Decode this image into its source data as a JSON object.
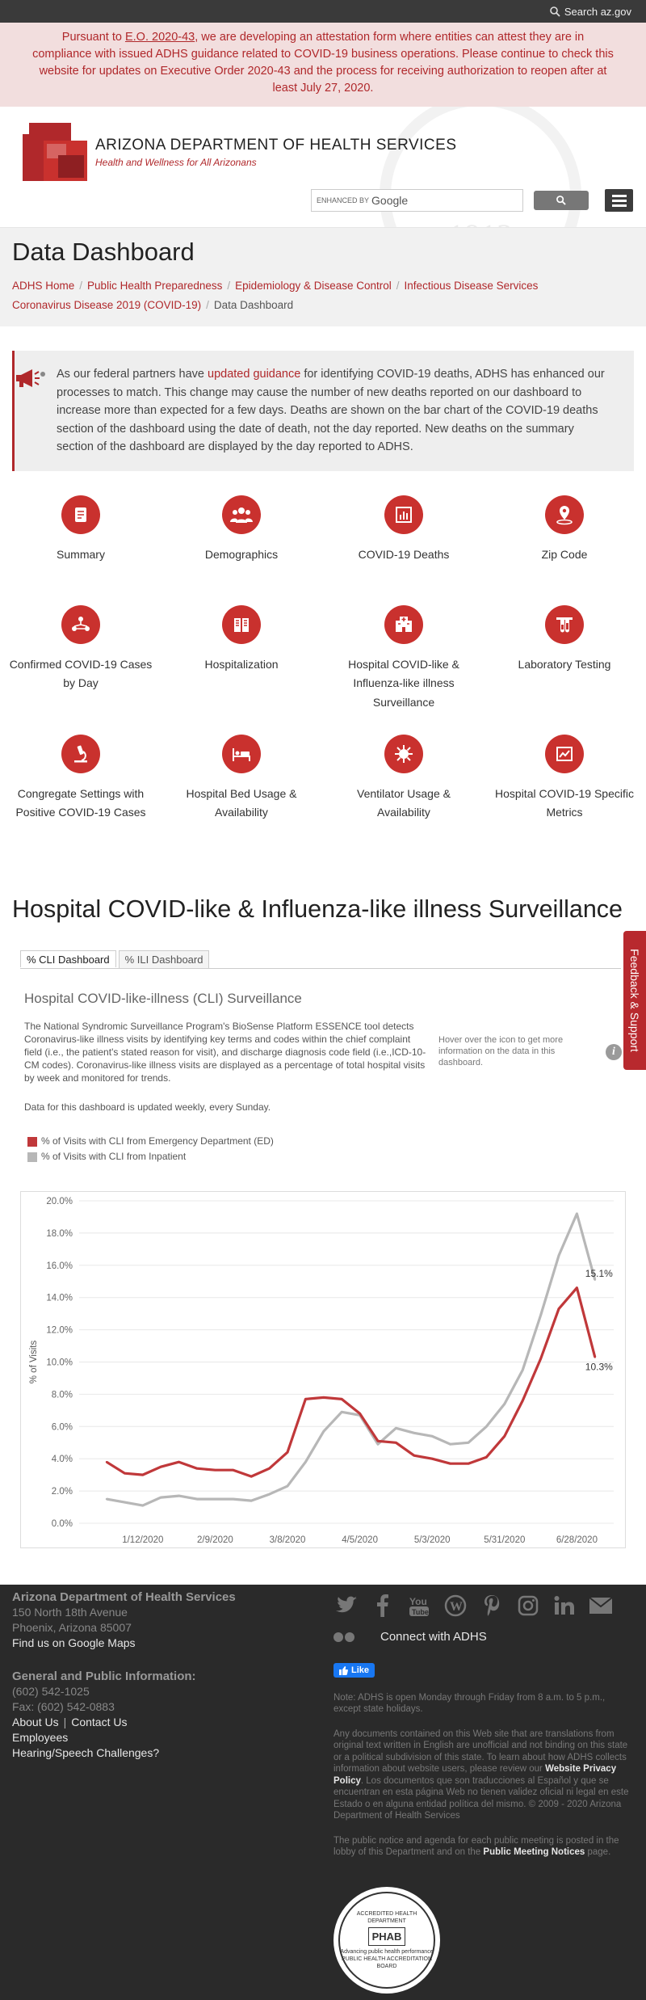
{
  "topbar": {
    "search_link": "Search az.gov"
  },
  "alert": {
    "part1": "Pursuant to ",
    "eo_link": "E.O. 2020-43",
    "part2": ", we are developing an attestation form where entities can attest they are in compliance with issued ADHS guidance related to COVID-19 business operations. Please continue to check this website for updates on Executive Order 2020-43 and the process for receiving authorization to reopen after at least July 27, 2020."
  },
  "header": {
    "title": "ARIZONA DEPARTMENT OF HEALTH SERVICES",
    "tagline": "Health and Wellness for All Arizonans",
    "seal_year": "1912",
    "search_enhanced": "ENHANCED BY",
    "search_google": "Google",
    "search_button_icon": "search-icon",
    "menu_icon": "hamburger-icon"
  },
  "page": {
    "title": "Data Dashboard",
    "breadcrumbs": [
      "ADHS Home",
      "Public Health Preparedness",
      "Epidemiology & Disease Control",
      "Infectious Disease Services",
      "Coronavirus Disease 2019 (COVID-19)",
      "Data Dashboard"
    ]
  },
  "notice": {
    "pre": "As our federal partners have ",
    "link": "updated guidance",
    "post": " for identifying COVID-19 deaths, ADHS has enhanced our processes to match. This change may cause the number of new deaths reported on our dashboard to increase more than expected for a few days. Deaths are shown on the bar chart of the COVID-19 deaths section of the dashboard using the date of death, not the day reported. New deaths on the summary section of the dashboard are displayed by the day reported to ADHS."
  },
  "dashboard_links": [
    {
      "label": "Summary",
      "icon": "document-icon"
    },
    {
      "label": "Demographics",
      "icon": "people-icon"
    },
    {
      "label": "COVID-19 Deaths",
      "icon": "bar-chart-icon"
    },
    {
      "label": "Zip Code",
      "icon": "location-pin-icon"
    },
    {
      "label": "Confirmed COVID-19 Cases by Day",
      "icon": "network-icon"
    },
    {
      "label": "Hospitalization",
      "icon": "hospital-building-icon"
    },
    {
      "label": "Hospital COVID-like & Influenza-like illness Surveillance",
      "icon": "hospital-icon"
    },
    {
      "label": "Laboratory Testing",
      "icon": "test-tube-icon"
    },
    {
      "label": "Congregate Settings with Positive COVID-19 Cases",
      "icon": "microscope-icon"
    },
    {
      "label": "Hospital Bed Usage & Availability",
      "icon": "bed-icon"
    },
    {
      "label": "Ventilator Usage & Availability",
      "icon": "virus-icon"
    },
    {
      "label": "Hospital COVID-19 Specific Metrics",
      "icon": "line-chart-icon"
    }
  ],
  "section": {
    "title": "Hospital COVID-like & Influenza-like illness Surveillance",
    "tabs": [
      "% CLI Dashboard",
      "% ILI Dashboard"
    ],
    "cli_title": "Hospital COVID-like-illness (CLI) Surveillance",
    "cli_desc": "The National Syndromic Surveillance Program's BioSense Platform ESSENCE tool detects Coronavirus-like illness visits by identifying key terms and codes within the chief complaint field (i.e., the patient's stated reason for visit), and discharge diagnosis code field (i.e.,ICD-10-CM codes).  Coronavirus-like illness visits are displayed as a percentage of total hospital visits by week and monitored for trends.",
    "cli_update": "Data for this dashboard is updated weekly, every Sunday.",
    "hover_note": "Hover over the icon to get more information on the data in this dashboard.",
    "info_icon": "info-icon",
    "feedback": "Feedback & Support"
  },
  "chart_data": {
    "type": "line",
    "ylabel": "% of Visits",
    "ylim": [
      0,
      20
    ],
    "yticks": [
      "0.0%",
      "2.0%",
      "4.0%",
      "6.0%",
      "8.0%",
      "10.0%",
      "12.0%",
      "14.0%",
      "16.0%",
      "18.0%",
      "20.0%"
    ],
    "xticks": [
      "1/12/2020",
      "2/9/2020",
      "3/8/2020",
      "4/5/2020",
      "5/3/2020",
      "5/31/2020",
      "6/28/2020"
    ],
    "x": [
      "12/29/2019",
      "1/5/2020",
      "1/12/2020",
      "1/19/2020",
      "1/26/2020",
      "2/2/2020",
      "2/9/2020",
      "2/16/2020",
      "2/23/2020",
      "3/1/2020",
      "3/8/2020",
      "3/15/2020",
      "3/22/2020",
      "3/29/2020",
      "4/5/2020",
      "4/12/2020",
      "4/19/2020",
      "4/26/2020",
      "5/3/2020",
      "5/10/2020",
      "5/17/2020",
      "5/24/2020",
      "5/31/2020",
      "6/7/2020",
      "6/14/2020",
      "6/21/2020",
      "6/28/2020",
      "7/5/2020",
      "7/12/2020"
    ],
    "series": [
      {
        "name": "% of Visits with CLI from Emergency Department (ED)",
        "color": "#c0383a",
        "values": [
          3.8,
          3.1,
          3.0,
          3.5,
          3.8,
          3.4,
          3.3,
          3.3,
          2.9,
          3.4,
          4.4,
          7.7,
          7.8,
          7.7,
          6.8,
          5.1,
          5.0,
          4.2,
          4.0,
          3.7,
          3.7,
          4.1,
          5.4,
          7.6,
          10.2,
          13.3,
          14.6,
          10.3
        ],
        "end_label": "10.3%"
      },
      {
        "name": "% of Visits with CLI from Inpatient",
        "color": "#b7b7b7",
        "values": [
          1.5,
          1.3,
          1.1,
          1.6,
          1.7,
          1.5,
          1.5,
          1.5,
          1.4,
          1.8,
          2.3,
          3.8,
          5.7,
          6.9,
          6.7,
          4.9,
          5.9,
          5.6,
          5.4,
          4.9,
          5.0,
          6.0,
          7.4,
          9.5,
          12.9,
          16.6,
          19.2,
          15.1
        ],
        "end_label": "15.1%"
      }
    ]
  },
  "footer": {
    "org": "Arizona Department of Health Services",
    "addr1": "150 North 18th Avenue",
    "addr2": "Phoenix, Arizona 85007",
    "maps": "Find us on Google Maps",
    "gen_title": "General and Public Information:",
    "phone": "(602) 542-1025",
    "fax": "Fax: (602) 542-0883",
    "about": "About Us",
    "contact": "Contact Us",
    "employees": "Employees",
    "hearing": "Hearing/Speech Challenges?",
    "social": [
      "twitter-icon",
      "facebook-icon",
      "youtube-icon",
      "wordpress-icon",
      "pinterest-icon",
      "instagram-icon",
      "linkedin-icon",
      "email-icon"
    ],
    "connect": "Connect with ADHS",
    "like": "Like",
    "note": "Note: ADHS is open Monday through Friday from 8 a.m. to 5 p.m., except state holidays.",
    "translation_pre": "Any documents contained on this Web site that are translations from original text written in English are unofficial and not binding on this state or a political subdivision of this state. To learn about how ADHS collects information about website users, please review our ",
    "privacy": "Website Privacy Policy",
    "translation_post": ". Los documentos que son traducciones al Español y que se encuentran en esta página Web no tienen validez oficial ni legal en este Estado o en alguna entidad política del mismo. © 2009 - 2020 Arizona Department of Health Services",
    "public_pre": "The public notice and agenda for each public meeting is posted in the lobby of this Department and on the ",
    "public_link": "Public Meeting Notices",
    "public_post": " page.",
    "phab_top": "ACCREDITED HEALTH DEPARTMENT",
    "phab_mark": "PHAB",
    "phab_sub": "Advancing public health performance",
    "phab_bottom": "PUBLIC HEALTH ACCREDITATION BOARD"
  }
}
